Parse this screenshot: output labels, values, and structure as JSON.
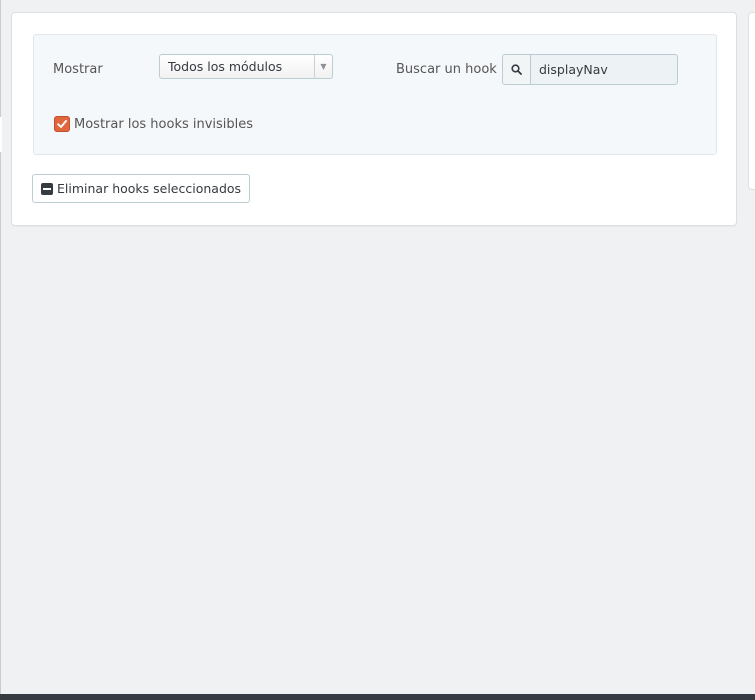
{
  "filters": {
    "show_label": "Mostrar",
    "module_select": {
      "selected": "Todos los módulos"
    },
    "search_label": "Buscar un hook",
    "search_input": {
      "value": "displayNav"
    },
    "show_invisible": {
      "label": "Mostrar los hooks invisibles",
      "checked": true
    }
  },
  "actions": {
    "delete_selected_label": "Eliminar hooks seleccionados"
  },
  "colors": {
    "checkbox_accent": "#e0663e",
    "page_background": "#eff1f2"
  },
  "icons": [
    "chevron-down-icon",
    "search-icon",
    "check-icon",
    "minus-square-icon"
  ]
}
